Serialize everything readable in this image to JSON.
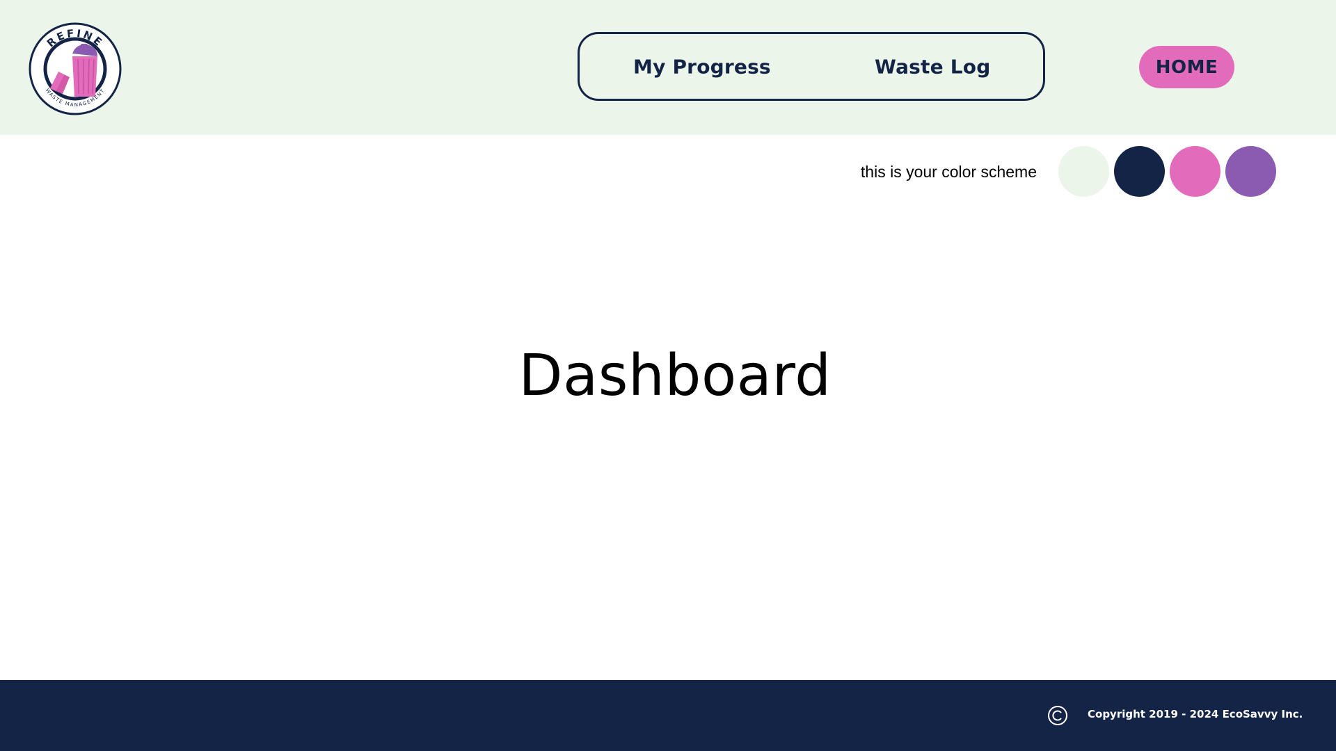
{
  "header": {
    "logo": {
      "icon": "refine-waste-bin-logo",
      "brand_text": "REFINE",
      "tagline": "WASTE MANAGEMENT"
    },
    "nav": {
      "my_progress": "My Progress",
      "waste_log": "Waste Log"
    },
    "home_button": "HOME"
  },
  "color_scheme": {
    "label": "this is your color scheme",
    "swatches": [
      "#ebf5ea",
      "#142446",
      "#e36bbb",
      "#8a5bb0"
    ]
  },
  "main": {
    "title": "Dashboard"
  },
  "footer": {
    "copyright_icon": "copyright-icon",
    "copyright_text": "Copyright 2019 - 2024 EcoSavvy Inc."
  },
  "colors": {
    "header_bg": "#ebf5ea",
    "navy": "#142446",
    "pink": "#e36bbb",
    "purple": "#8a5bb0",
    "white": "#ffffff"
  }
}
